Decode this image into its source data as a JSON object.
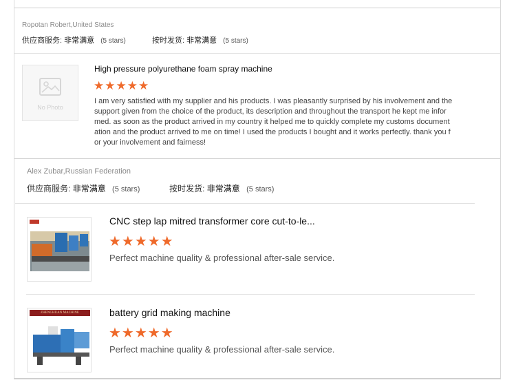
{
  "reviews": [
    {
      "reviewer": "Ropotan Robert,United States",
      "supplier_service_label": "供应商服务:",
      "supplier_service_value": "非常满意",
      "supplier_service_stars": "(5 stars)",
      "ontime_label": "按时发货:",
      "ontime_value": "非常满意",
      "ontime_stars": "(5 stars)",
      "products": [
        {
          "image_placeholder": "No Photo",
          "title": "High pressure polyurethane foam spray machine",
          "rating": 5,
          "stars_text": "★★★★★",
          "lines": [
            "I am very satisfied with my supplier and his products. I was pleasantly surprised by his involvement and the",
            "support given from the choice of the product, its description and throughout the transport he kept me infor",
            "med. as soon as the product arrived in my country it helped me to quickly complete my customs document",
            "ation and the product arrived to me on time! I used the products I bought and it works perfectly. thank you f",
            "or your involvement and fairness!"
          ]
        }
      ]
    },
    {
      "reviewer": "Alex Zubar,Russian Federation",
      "supplier_service_label": "供应商服务:",
      "supplier_service_value": "非常满意",
      "supplier_service_stars": "(5 stars)",
      "ontime_label": "按时发货:",
      "ontime_value": "非常满意",
      "ontime_stars": "(5 stars)",
      "products": [
        {
          "title": "CNC step lap mitred transformer core cut-to-le...",
          "rating": 5,
          "stars_text": "★★★★★",
          "comment": "Perfect machine quality & professional after-sale service."
        },
        {
          "title": "battery grid making machine",
          "rating": 5,
          "stars_text": "★★★★★",
          "comment": "Perfect machine quality & professional after-sale service.",
          "banner_text": "ZHENGHUAN MACHINE"
        }
      ]
    }
  ]
}
